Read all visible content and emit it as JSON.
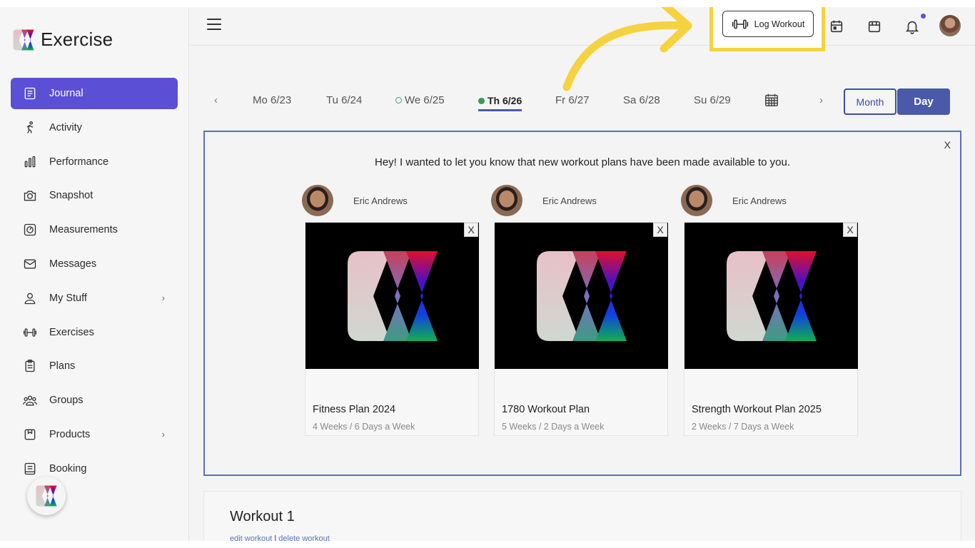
{
  "app": {
    "name": "Exercise"
  },
  "sidebar": {
    "items": [
      {
        "label": "Journal",
        "icon": "journal-icon",
        "active": true
      },
      {
        "label": "Activity",
        "icon": "activity-icon"
      },
      {
        "label": "Performance",
        "icon": "performance-icon"
      },
      {
        "label": "Snapshot",
        "icon": "camera-icon"
      },
      {
        "label": "Measurements",
        "icon": "measurements-icon"
      },
      {
        "label": "Messages",
        "icon": "mail-icon"
      },
      {
        "label": "My Stuff",
        "icon": "user-icon",
        "has_submenu": true
      },
      {
        "label": "Exercises",
        "icon": "dumbbell-icon"
      },
      {
        "label": "Plans",
        "icon": "clipboard-icon"
      },
      {
        "label": "Groups",
        "icon": "group-icon"
      },
      {
        "label": "Products",
        "icon": "product-icon",
        "has_submenu": true
      },
      {
        "label": "Booking",
        "icon": "booking-icon"
      }
    ]
  },
  "topbar": {
    "log_workout_label": "Log Workout",
    "icons": [
      "calendar-icon",
      "store-icon",
      "bell-icon",
      "avatar"
    ]
  },
  "days": {
    "items": [
      {
        "label": "Mo 6/23"
      },
      {
        "label": "Tu 6/24"
      },
      {
        "label": "We 6/25",
        "marker": "open"
      },
      {
        "label": "Th 6/26",
        "marker": "filled",
        "current": true
      },
      {
        "label": "Fr 6/27"
      },
      {
        "label": "Sa 6/28"
      },
      {
        "label": "Su 6/29"
      }
    ],
    "view_month": "Month",
    "view_day": "Day"
  },
  "announcement": {
    "close_label": "X",
    "message": "Hey! I wanted to let you know that new workout plans have been made available to you.",
    "plans": [
      {
        "author": "Eric Andrews",
        "title": "Fitness Plan 2024",
        "subtitle": "4 Weeks / 6 Days a Week",
        "close_label": "X"
      },
      {
        "author": "Eric Andrews",
        "title": "1780 Workout Plan",
        "subtitle": "5 Weeks / 2 Days a Week",
        "close_label": "X"
      },
      {
        "author": "Eric Andrews",
        "title": "Strength Workout Plan 2025",
        "subtitle": "2 Weeks / 7 Days a Week",
        "close_label": "X"
      }
    ]
  },
  "workout": {
    "title": "Workout 1",
    "edit_label": "edit workout",
    "separator": "|",
    "delete_label": "delete workout"
  },
  "colors": {
    "accent": "#5b4fd6",
    "primary_blue": "#4a5aa8",
    "highlight_yellow": "#f6d23e"
  }
}
